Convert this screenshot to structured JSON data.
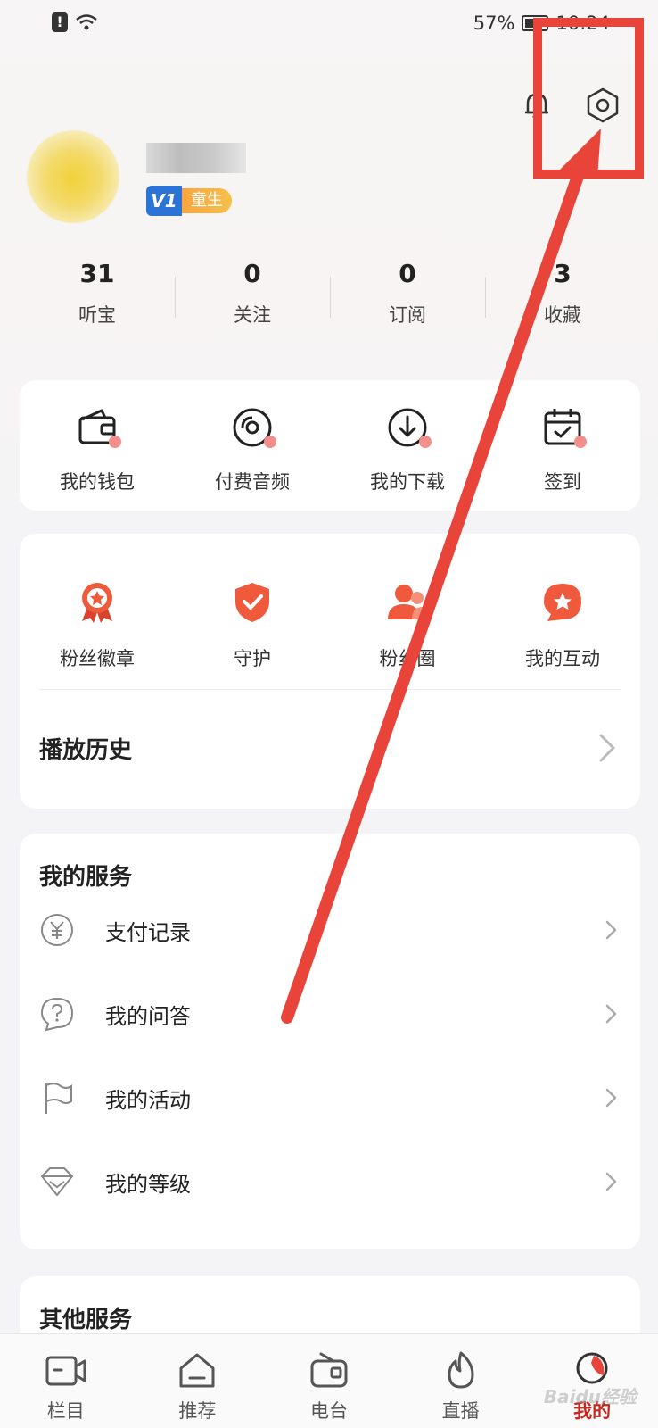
{
  "status_bar": {
    "battery": "57%",
    "time": "10:24"
  },
  "profile": {
    "level_badge": "童生",
    "v_badge": "V1"
  },
  "stats": [
    {
      "value": "31",
      "label": "听宝"
    },
    {
      "value": "0",
      "label": "关注"
    },
    {
      "value": "0",
      "label": "订阅"
    },
    {
      "value": "3",
      "label": "收藏"
    }
  ],
  "quick": [
    {
      "label": "我的钱包",
      "icon": "wallet-icon"
    },
    {
      "label": "付费音频",
      "icon": "disc-icon"
    },
    {
      "label": "我的下载",
      "icon": "download-icon"
    },
    {
      "label": "签到",
      "icon": "calendar-check-icon"
    }
  ],
  "fans": [
    {
      "label": "粉丝徽章",
      "icon": "medal-icon"
    },
    {
      "label": "守护",
      "icon": "shield-check-icon"
    },
    {
      "label": "粉丝圈",
      "icon": "users-icon"
    },
    {
      "label": "我的互动",
      "icon": "chat-star-icon"
    }
  ],
  "history": {
    "title": "播放历史"
  },
  "services": {
    "title": "我的服务",
    "items": [
      {
        "label": "支付记录",
        "icon": "yuan-icon"
      },
      {
        "label": "我的问答",
        "icon": "question-icon"
      },
      {
        "label": "我的活动",
        "icon": "flag-icon"
      },
      {
        "label": "我的等级",
        "icon": "diamond-icon"
      }
    ]
  },
  "other": {
    "title": "其他服务"
  },
  "tabs": [
    {
      "label": "栏目",
      "icon": "video-icon"
    },
    {
      "label": "推荐",
      "icon": "home-icon"
    },
    {
      "label": "电台",
      "icon": "radio-icon"
    },
    {
      "label": "直播",
      "icon": "flame-icon"
    },
    {
      "label": "我的",
      "icon": "profile-icon",
      "active": true
    }
  ],
  "watermark": "Baidu经验",
  "colors": {
    "accent": "#c6271f",
    "annotation": "#e8443a",
    "icon_red": "#ef5a3c"
  }
}
